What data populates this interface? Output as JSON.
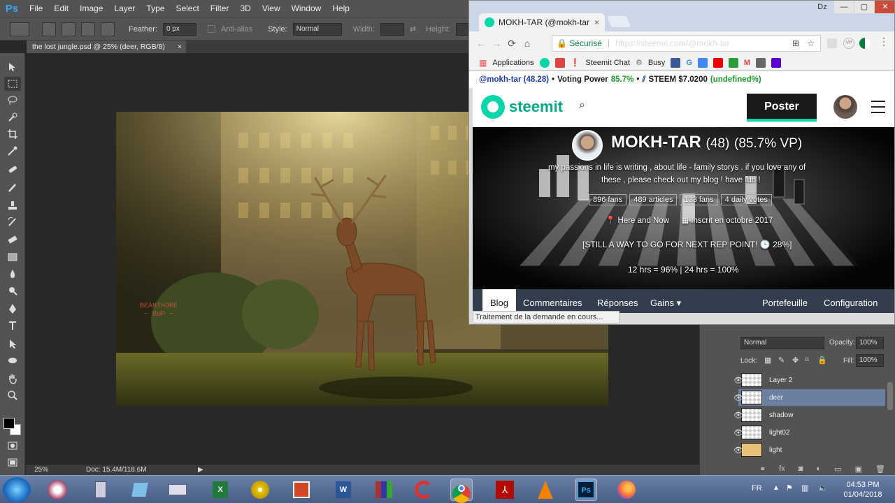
{
  "photoshop": {
    "logo": "Ps",
    "menu": [
      "File",
      "Edit",
      "Image",
      "Layer",
      "Type",
      "Select",
      "Filter",
      "3D",
      "View",
      "Window",
      "Help"
    ],
    "options": {
      "feather_label": "Feather:",
      "feather_value": "0 px",
      "antialias_label": "Anti-alias",
      "style_label": "Style:",
      "style_value": "Normal",
      "width_label": "Width:",
      "height_label": "Height:"
    },
    "document_tab": "the lost jungle.psd @ 25% (deer, RGB/8)",
    "document_tab_close": "×",
    "artwork_sign_line1": "BEANTHORE",
    "artwork_sign_line2": "~ BUP ~",
    "status": {
      "zoom": "25%",
      "doc": "Doc: 15.4M/118.6M"
    },
    "layers_panel": {
      "blend_mode": "Normal",
      "opacity_label": "Opacity:",
      "opacity_value": "100%",
      "lock_label": "Lock:",
      "fill_label": "Fill:",
      "fill_value": "100%",
      "layers": [
        {
          "name": "Layer 2",
          "selected": false
        },
        {
          "name": "deer",
          "selected": true
        },
        {
          "name": "shadow",
          "selected": false
        },
        {
          "name": "light02",
          "selected": false
        },
        {
          "name": "light",
          "selected": false
        }
      ]
    }
  },
  "chrome": {
    "tab_title": "MOKH-TAR (@mokh-tar",
    "tab_close": "×",
    "window_user": "Dz",
    "secure_label": "Sécurisé",
    "url": "https://steemit.com/@mokh-tar",
    "bookmarks": [
      "Applications",
      "Steemit Chat",
      "Busy"
    ],
    "extension_bar": {
      "user": "@mokh-tar (48.28)",
      "voting_power_label": "Voting Power",
      "voting_power_value": "85.7%",
      "steem_label": "STEEM $7.0200",
      "undefined": "(undefined%)"
    },
    "status_text": "Traitement de la demande en cours..."
  },
  "steemit": {
    "logo_text": "steemit",
    "poster_button": "Poster",
    "profile": {
      "name": "MOKH-TAR",
      "rep": "(48)",
      "vp": "(85.7% VP)",
      "bio_line1": "my passions in life is writing , about life - family storys . if you love any of",
      "bio_line2": "these , please check out my blog ! have fun !",
      "stats": [
        "896 fans",
        "489 articles",
        "133 fans",
        "4 daily votes"
      ],
      "location": "Here and Now",
      "joined": "Inscrit en octobre 2017",
      "rep_progress": "[STILL A WAY TO GO FOR NEXT REP POINT! 🕒 28%]",
      "vp_recovery": "12 hrs = 96% | 24 hrs = 100%"
    },
    "nav": {
      "tabs": [
        "Blog",
        "Commentaires",
        "Réponses",
        "Gains ▾"
      ],
      "right": [
        "Portefeuille",
        "Configuration"
      ]
    }
  },
  "taskbar": {
    "language": "FR",
    "time": "04:53 PM",
    "date": "01/04/2018"
  }
}
